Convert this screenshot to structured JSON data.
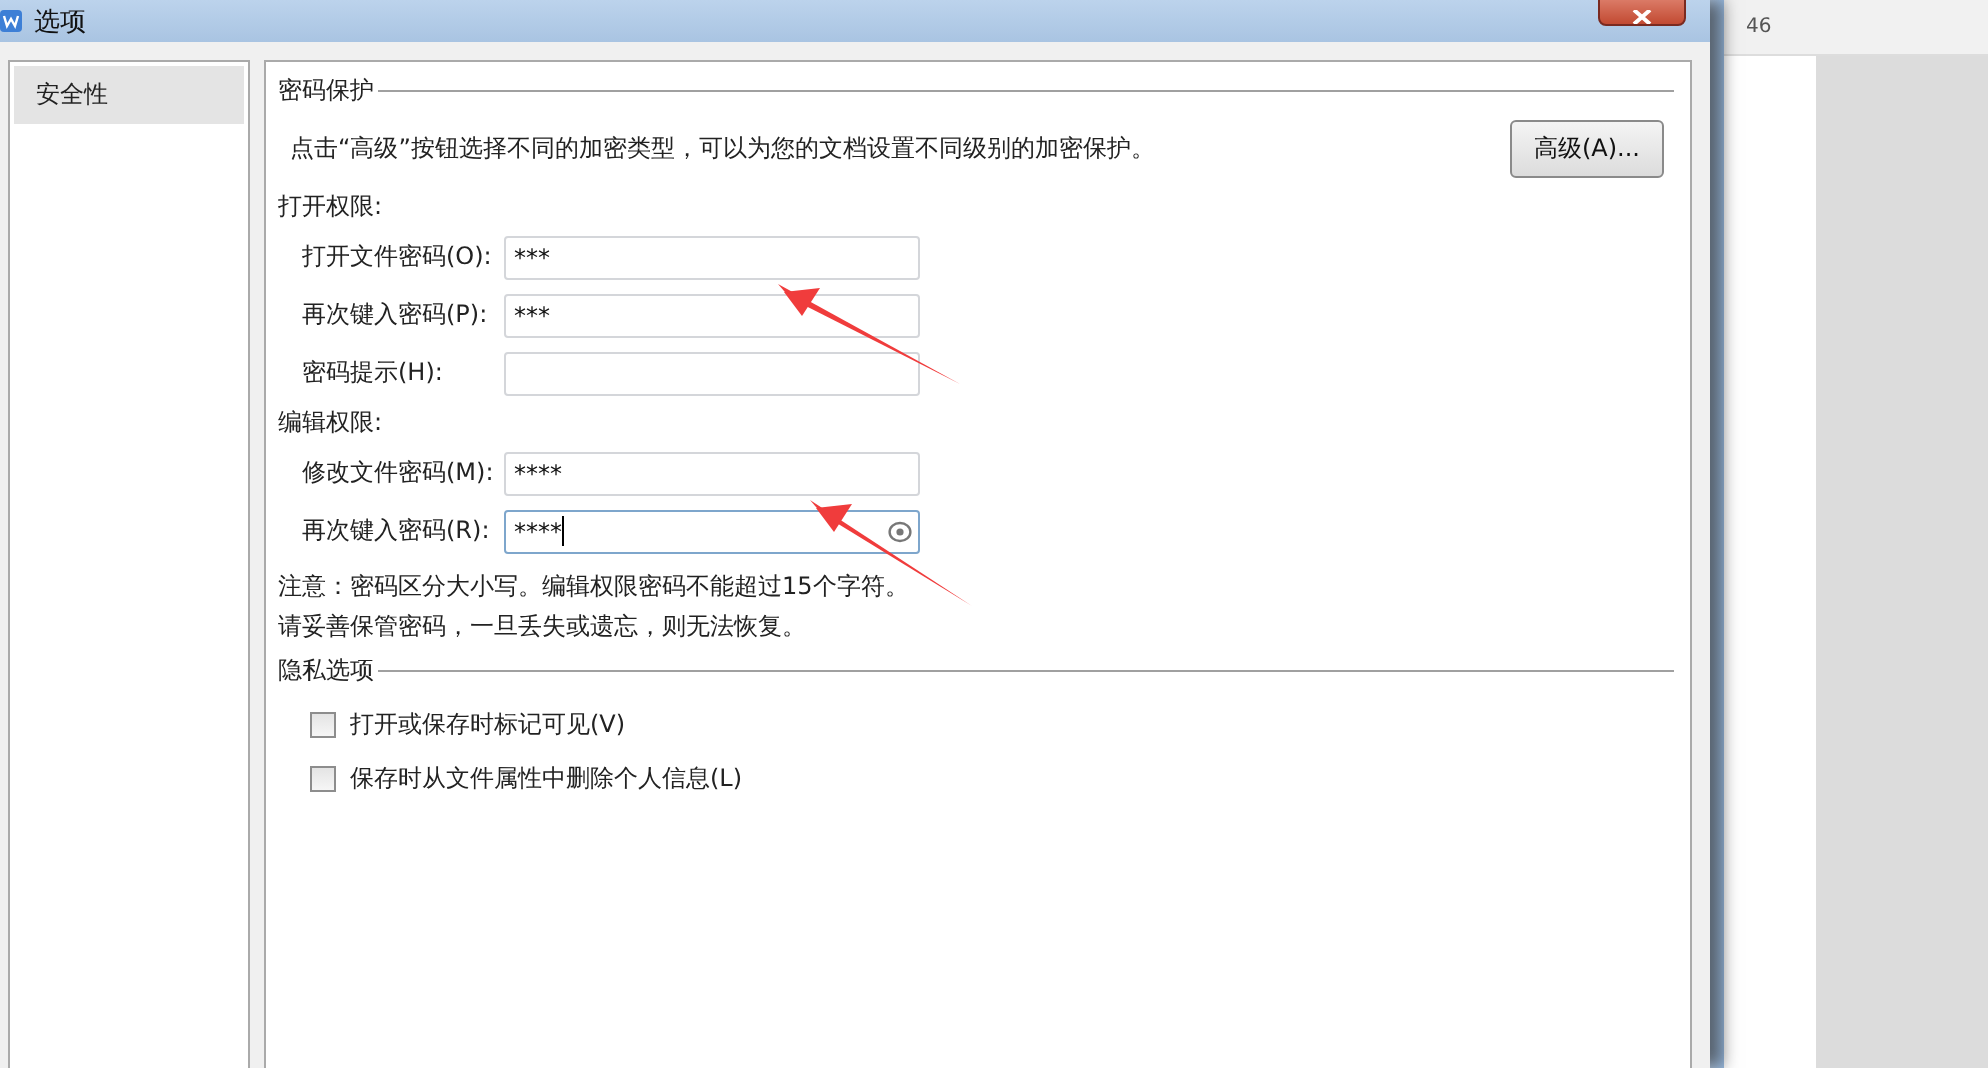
{
  "window": {
    "title": "选项"
  },
  "sidebar": {
    "items": [
      {
        "label": "安全性",
        "selected": true
      }
    ]
  },
  "password_protection": {
    "title": "密码保护",
    "description": "点击“高级”按钮选择不同的加密类型，可以为您的文档设置不同级别的加密保护。",
    "advanced_button": "高级(A)...",
    "groups": [
      {
        "title": "打开权限:",
        "fields": [
          {
            "label": "打开文件密码(O):",
            "value": "***",
            "focused": false
          },
          {
            "label": "再次键入密码(P):",
            "value": "***",
            "focused": false
          },
          {
            "label": "密码提示(H):",
            "focused": false
          }
        ]
      },
      {
        "title": "编辑权限:",
        "fields": [
          {
            "label": "修改文件密码(M):",
            "value": "****",
            "focused": false
          },
          {
            "label": "再次键入密码(R):",
            "value": "****",
            "focused": true
          }
        ]
      }
    ],
    "notes": [
      "注意：密码区分大小写。编辑权限密码不能超过15个字符。",
      "请妥善保管密码，一旦丢失或遗忘，则无法恢复。"
    ]
  },
  "privacy": {
    "title": "隐私选项",
    "options": [
      {
        "label": "打开或保存时标记可见(V)",
        "checked": false
      },
      {
        "label": "保存时从文件属性中删除个人信息(L)",
        "checked": false
      }
    ]
  },
  "background_document": {
    "ruler_number": "46"
  }
}
